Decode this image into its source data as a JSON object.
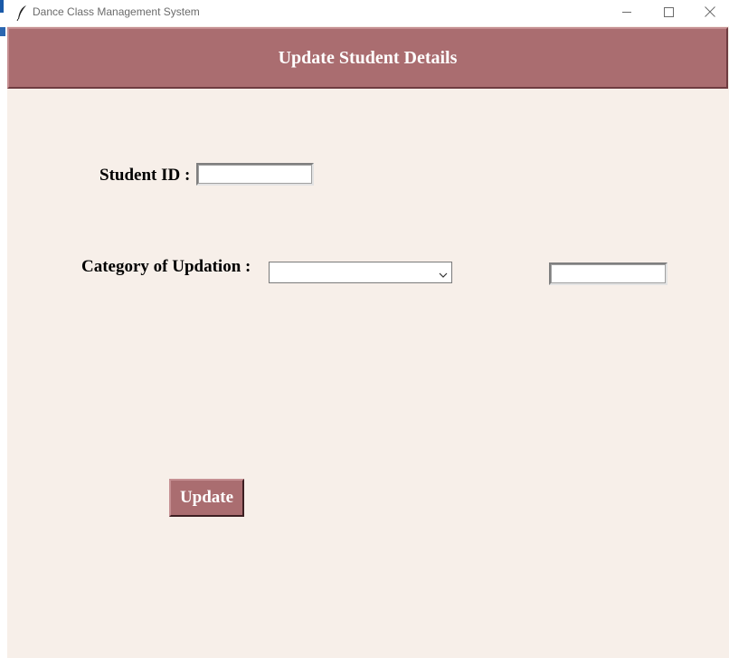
{
  "window": {
    "title": "Dance Class Management System",
    "controls": {
      "minimize_icon": "minimize-icon",
      "maximize_icon": "maximize-icon",
      "close_icon": "close-icon"
    }
  },
  "header": {
    "title": "Update Student Details"
  },
  "form": {
    "student_id_label": "Student ID :",
    "student_id_value": "",
    "category_label": "Category of Updation :",
    "category_selected": "",
    "new_value": "",
    "update_label": "Update"
  },
  "colors": {
    "accent": "#aa6d70",
    "background": "#f7efe9",
    "header_text": "#ffffff"
  }
}
